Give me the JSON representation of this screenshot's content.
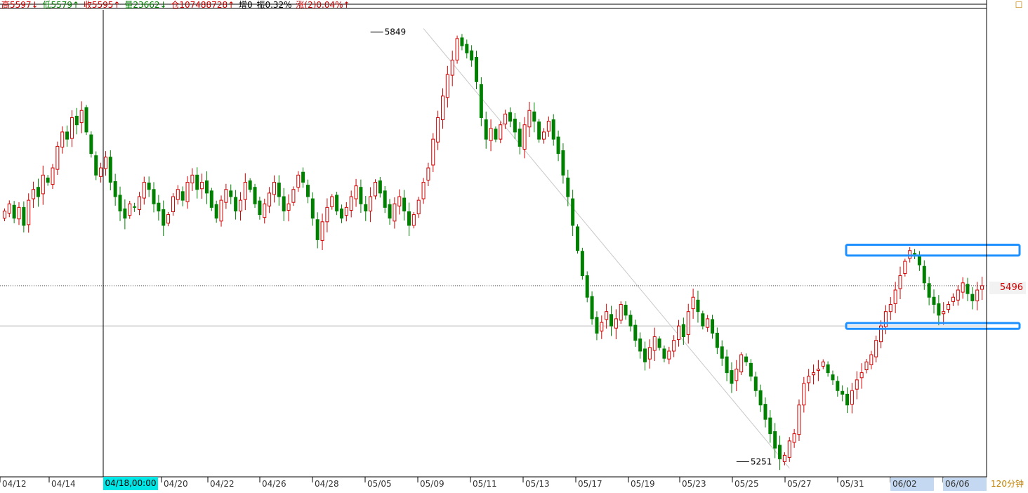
{
  "info_bar": {
    "high": "高5597↓",
    "low": "低5579↑",
    "close": "收5595↑",
    "volume": "量23662↓",
    "open_interest": "仓107488728↑",
    "oi_change": "增0",
    "amplitude": "振0.32%",
    "change": "涨(2)0.04%↑"
  },
  "period": "120分钟",
  "cursor_time": "04/18,00:00",
  "last_price_label": "5496",
  "corner_icon": "settings-icon",
  "colors": {
    "up": "#d00000",
    "down": "#008000",
    "cursor": "#00e5e5",
    "highlight_box": "#1e90ff",
    "period": "#c08000"
  },
  "chart_data": {
    "type": "candlestick",
    "title": "",
    "xlabel": "",
    "ylabel": "",
    "ylim": [
      5230,
      5880
    ],
    "x_ticks": [
      "04/12",
      "04/14",
      "04/20",
      "04/22",
      "04/26",
      "04/28",
      "05/05",
      "05/09",
      "05/11",
      "05/13",
      "05/17",
      "05/19",
      "05/23",
      "05/25",
      "05/27",
      "05/31",
      "06/02",
      "06/06"
    ],
    "annotations": [
      {
        "label": "5849",
        "value": 5849,
        "date": "05/05"
      },
      {
        "label": "5251",
        "value": 5251,
        "date": "05/25"
      }
    ],
    "horizontal_lines": [
      5496,
      5440
    ],
    "highlight_zones": [
      {
        "from": 5538,
        "to": 5553
      },
      {
        "from": 5436,
        "to": 5444
      }
    ],
    "trendline": {
      "from": {
        "date": "05/09",
        "value": 5854
      },
      "to": {
        "date": "05/27",
        "value": 5242
      }
    },
    "series": [
      {
        "values": [
          5600,
          5610,
          5590,
          5605,
          5580,
          5615,
          5630,
          5620,
          5650,
          5640,
          5660,
          5690,
          5710,
          5700,
          5730,
          5720,
          5740,
          5710,
          5680,
          5650,
          5660,
          5675,
          5640,
          5620,
          5600,
          5590,
          5610,
          5605,
          5620,
          5640,
          5630,
          5610,
          5600,
          5580,
          5595,
          5620,
          5630,
          5615,
          5640,
          5650,
          5630,
          5640,
          5625,
          5605,
          5590,
          5615,
          5630,
          5620,
          5600,
          5615,
          5640,
          5630,
          5610,
          5595,
          5610,
          5625,
          5640,
          5620,
          5600,
          5610,
          5630,
          5650,
          5640,
          5620,
          5590,
          5560,
          5585,
          5605,
          5620,
          5600,
          5590,
          5605,
          5620,
          5635,
          5610,
          5600,
          5620,
          5640,
          5625,
          5605,
          5590,
          5610,
          5620,
          5600,
          5580,
          5595,
          5615,
          5640,
          5660,
          5700,
          5730,
          5760,
          5790,
          5810,
          5840,
          5830,
          5820,
          5810,
          5780,
          5730,
          5700,
          5715,
          5700,
          5720,
          5735,
          5725,
          5710,
          5690,
          5720,
          5740,
          5725,
          5700,
          5710,
          5725,
          5700,
          5680,
          5650,
          5620,
          5580,
          5545,
          5510,
          5480,
          5450,
          5430,
          5445,
          5460,
          5440,
          5450,
          5470,
          5455,
          5440,
          5420,
          5405,
          5390,
          5410,
          5425,
          5410,
          5395,
          5405,
          5420,
          5440,
          5425,
          5460,
          5480,
          5460,
          5440,
          5450,
          5430,
          5410,
          5395,
          5375,
          5360,
          5380,
          5400,
          5390,
          5370,
          5350,
          5330,
          5310,
          5290,
          5270,
          5255,
          5260,
          5280,
          5290,
          5330,
          5360,
          5370,
          5375,
          5380,
          5390,
          5375,
          5365,
          5350,
          5345,
          5330,
          5350,
          5365,
          5375,
          5390,
          5400,
          5420,
          5440,
          5460,
          5470,
          5490,
          5510,
          5530,
          5545,
          5540,
          5525,
          5500,
          5480,
          5470,
          5455,
          5460,
          5470,
          5480,
          5490,
          5500,
          5485,
          5475,
          5490,
          5496
        ]
      }
    ]
  }
}
